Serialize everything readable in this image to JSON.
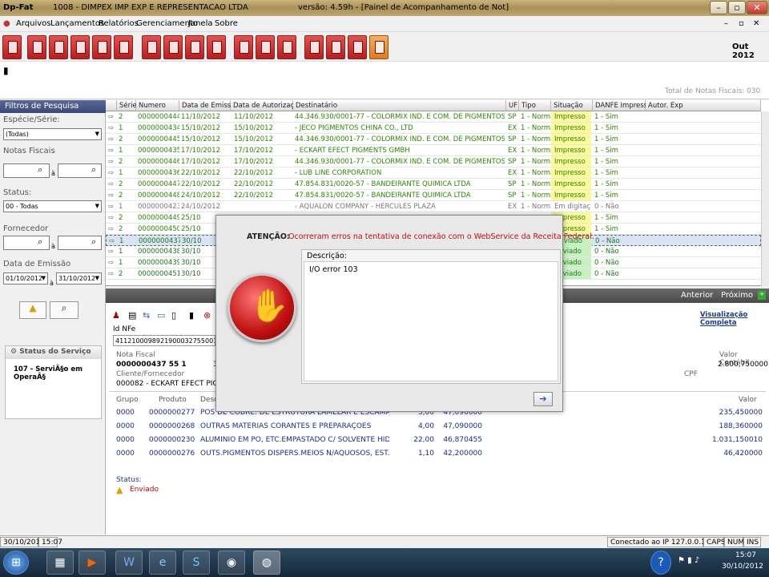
{
  "window": {
    "app": "Dp-Fat",
    "company": "1008 - DIMPEX IMP  EXP E REPRESENTACAO LTDA",
    "version": "versão: 4.59h - [Painel de Acompanhamento de Not]"
  },
  "menu": [
    "Arquivos",
    "Lançamentos",
    "Relatórios",
    "Gerenciamento",
    "Janela",
    "Sobre"
  ],
  "toolbar": {
    "period": "Out  2012",
    "total_label": "Total de Notas Fiscais: 030"
  },
  "filters": {
    "title": "Filtros de Pesquisa",
    "especie_label": "Espécie/Série:",
    "especie_value": "(Todas)",
    "notas_label": "Notas Fiscais",
    "a1": "à",
    "status_label": "Status:",
    "status_value": "00 - Todas",
    "fornecedor_label": "Fornecedor",
    "a2": "à",
    "data_label": "Data de Emissão",
    "date_from": "01/10/2012",
    "a3": "à",
    "date_to": "31/10/2012",
    "servico_title": "Status do Serviço",
    "servico_value": "107 - ServiÃ§o em OperaÃ§"
  },
  "grid": {
    "headers": [
      "Série",
      "Numero",
      "Data de Emissão",
      "Data de Autorização",
      "Destinatário",
      "UF",
      "Tipo",
      "Situação",
      "DANFE Impresso",
      "Autor. Exp"
    ],
    "rows": [
      [
        "2",
        "0000000444",
        "11/10/2012",
        "11/10/2012",
        "44.346.930/0001-77 - COLORMIX IND. E COM. DE PIGMENTOS LTDA",
        "SP",
        "1 - Normal",
        "Impresso",
        "1 - Sim"
      ],
      [
        "1",
        "0000000434",
        "15/10/2012",
        "15/10/2012",
        " - JECO PIGMENTOS CHINA CO., LTD",
        "EX",
        "1 - Normal",
        "Impresso",
        "1 - Sim"
      ],
      [
        "2",
        "0000000445",
        "15/10/2012",
        "15/10/2012",
        "44.346.930/0001-77 - COLORMIX IND. E COM. DE PIGMENTOS LTDA",
        "SP",
        "1 - Normal",
        "Impresso",
        "1 - Sim"
      ],
      [
        "1",
        "0000000435",
        "17/10/2012",
        "17/10/2012",
        " - ECKART EFECT PIGMENTS GMBH",
        "EX",
        "1 - Normal",
        "Impresso",
        "1 - Sim"
      ],
      [
        "2",
        "0000000446",
        "17/10/2012",
        "17/10/2012",
        "44.346.930/0001-77 - COLORMIX IND. E COM. DE PIGMENTOS LTDA",
        "SP",
        "1 - Normal",
        "Impresso",
        "1 - Sim"
      ],
      [
        "1",
        "0000000436",
        "22/10/2012",
        "22/10/2012",
        " - LUB LINE CORPORATION",
        "EX",
        "1 - Normal",
        "Impresso",
        "1 - Sim"
      ],
      [
        "2",
        "0000000447",
        "22/10/2012",
        "22/10/2012",
        "47.854.831/0020-57 - BANDEIRANTE QUIMICA LTDA",
        "SP",
        "1 - Normal",
        "Impresso",
        "1 - Sim"
      ],
      [
        "2",
        "0000000448",
        "24/10/2012",
        "22/10/2012",
        "47.854.831/0020-57 - BANDEIRANTE QUIMICA LTDA",
        "SP",
        "1 - Normal",
        "Impresso",
        "1 - Sim"
      ],
      [
        "1",
        "0000000423",
        "24/10/2012",
        "",
        " - AQUALON COMPANY - HERCULES PLAZA",
        "EX",
        "1 - Normal",
        "Em digitação",
        "0 - Não"
      ],
      [
        "2",
        "0000000449",
        "25/10",
        "",
        "",
        "",
        "",
        "Impresso",
        "1 - Sim"
      ],
      [
        "2",
        "0000000450",
        "25/10",
        "",
        "",
        "",
        "",
        "Impresso",
        "1 - Sim"
      ],
      [
        "1",
        "0000000437",
        "30/10",
        "",
        "",
        "",
        "",
        "Enviado",
        "0 - Não"
      ],
      [
        "1",
        "0000000438",
        "30/10",
        "",
        "",
        "",
        "",
        "Enviado",
        "0 - Não"
      ],
      [
        "1",
        "0000000439",
        "30/10",
        "",
        "",
        "",
        "",
        "Enviado",
        "0 - Não"
      ],
      [
        "2",
        "0000000451",
        "30/10",
        "",
        "",
        "",
        "",
        "Enviado",
        "0 - Não"
      ]
    ]
  },
  "nav": {
    "prev": "Anterior",
    "next": "Próximo"
  },
  "detail": {
    "idnfe_label": "Id NFe",
    "idnfe_value": "41121000989219000327550010000",
    "viz": "Visualização Completa",
    "nf_label": "Nota Fiscal",
    "nf_value": "0000000437 55 1",
    "nf_extra": "3",
    "vc_label": "Valor Contábil",
    "vc_value": "2.800,750000",
    "cli_label": "Cliente/Fornecedor",
    "cli_value": "000082 - ECKART EFECT PIGMEN",
    "cpf_label": "CPF",
    "items_headers": [
      "Grupo",
      "Produto",
      "Descr",
      "Valor"
    ],
    "items": [
      [
        "0000",
        "0000000277",
        "POS DE COBRE. DE ESTRUTURA LAMELAR E ESCAMAS DE COE",
        "5,00",
        "47,090000",
        "235,450000"
      ],
      [
        "0000",
        "0000000268",
        "OUTRAS MATERIAS CORANTES E PREPARAÇÕES",
        "4,00",
        "47,090000",
        "188,360000"
      ],
      [
        "0000",
        "0000000230",
        "ALUMINIO EM PO, ETC.EMPASTADO C/ SOLVENTE HIDROCAR",
        "22,00",
        "46,870455",
        "1.031,150010"
      ],
      [
        "0000",
        "0000000276",
        "OUTS.PIGMENTOS DISPERS.MEIOS N/AQUOSOS, EST.LIQUID",
        "1,10",
        "42,200000",
        "46,420000"
      ]
    ],
    "status_label": "Status:",
    "status_value": "Enviado"
  },
  "dialog": {
    "label": "ATENÇÃO:",
    "message": "Ocorreram erros na tentativa de conexão com o WebService da Receita Federal.",
    "desc_label": "Descrição:",
    "desc_value": "I/O error 103"
  },
  "statusbar": {
    "datetime": "30/10/2012",
    "time": "15:07",
    "ip": "Conectado ao IP 127.0.0.1",
    "caps": "CAPS",
    "num": "NUM",
    "ins": "INS"
  },
  "clock": {
    "time": "15:07",
    "date": "30/10/2012"
  }
}
